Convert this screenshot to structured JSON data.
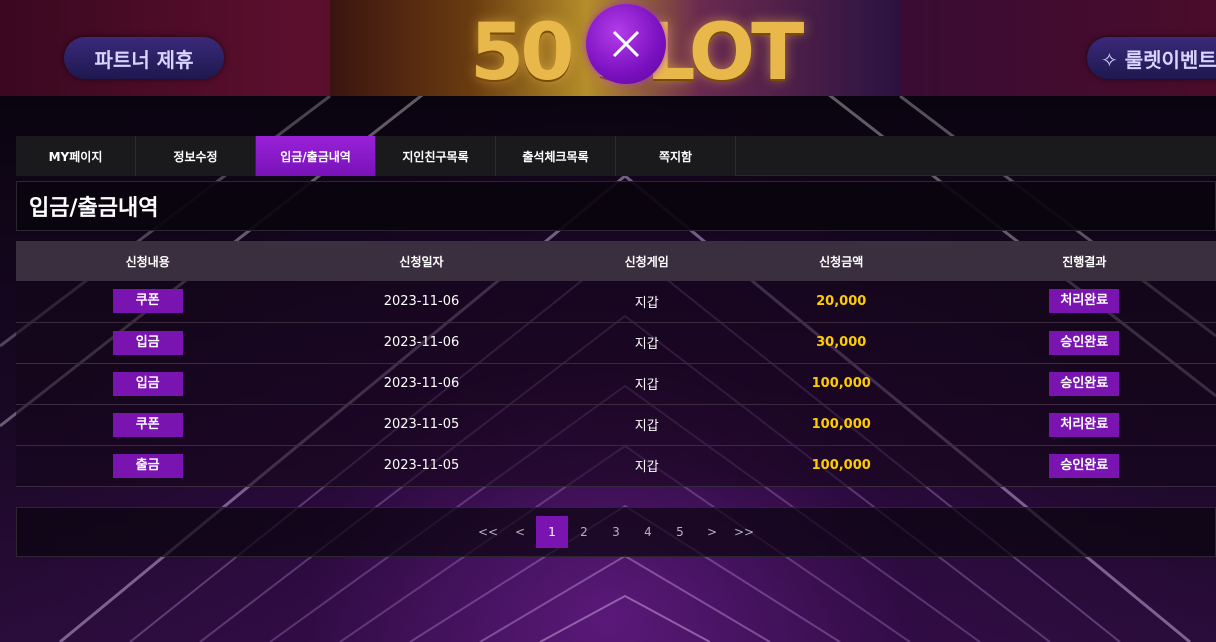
{
  "banner": {
    "left_button": "파트너 제휴",
    "right_button": "✧ 룰렛이벤트"
  },
  "tabs": [
    {
      "label": "MY페이지",
      "active": false
    },
    {
      "label": "정보수정",
      "active": false
    },
    {
      "label": "입금/출금내역",
      "active": true
    },
    {
      "label": "지인친구목록",
      "active": false
    },
    {
      "label": "출석체크목록",
      "active": false
    },
    {
      "label": "쪽지함",
      "active": false
    }
  ],
  "page_title": "입금/출금내역",
  "table": {
    "headers": [
      "신청내용",
      "신청일자",
      "신청게임",
      "신청금액",
      "진행결과"
    ],
    "rows": [
      {
        "type": "쿠폰",
        "date": "2023-11-06",
        "game": "지갑",
        "amount": "20,000",
        "result": "처리완료"
      },
      {
        "type": "입금",
        "date": "2023-11-06",
        "game": "지갑",
        "amount": "30,000",
        "result": "승인완료"
      },
      {
        "type": "입금",
        "date": "2023-11-06",
        "game": "지갑",
        "amount": "100,000",
        "result": "승인완료"
      },
      {
        "type": "쿠폰",
        "date": "2023-11-05",
        "game": "지갑",
        "amount": "100,000",
        "result": "처리완료"
      },
      {
        "type": "출금",
        "date": "2023-11-05",
        "game": "지갑",
        "amount": "100,000",
        "result": "승인완료"
      }
    ]
  },
  "pagination": {
    "first": "<<",
    "prev": "<",
    "pages": [
      "1",
      "2",
      "3",
      "4",
      "5"
    ],
    "current": "1",
    "next": ">",
    "last": ">>"
  },
  "colors": {
    "accent": "#7a14b0",
    "amount": "#ffcc00"
  }
}
